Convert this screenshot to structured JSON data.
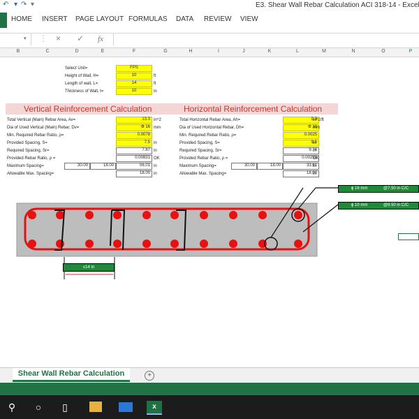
{
  "window": {
    "title": "E3. Shear Wall Rebar Calculation ACI 318-14 - Excel"
  },
  "ribbon": {
    "tabs": [
      "HOME",
      "INSERT",
      "PAGE LAYOUT",
      "FORMULAS",
      "DATA",
      "REVIEW",
      "VIEW"
    ]
  },
  "formula_bar": {
    "fx": "fx",
    "cancel": "×",
    "enter": "✓",
    "value": ""
  },
  "columns": [
    "B",
    "C",
    "D",
    "E",
    "F",
    "G",
    "H",
    "I",
    "J",
    "K",
    "L",
    "M",
    "N",
    "O",
    "P"
  ],
  "inputs": {
    "unit_label": "Select Unit=",
    "unit_value": "FPS",
    "height_label": "Height of Wall, H=",
    "height_value": "10",
    "height_unit": "ft",
    "length_label": "Length of wall, L=",
    "length_value": "14",
    "length_unit": "ft",
    "thick_label": "Thickness of Wall, t=",
    "thick_value": "10",
    "thick_unit": "in"
  },
  "vertical": {
    "title": "Vertical Reinforcement Calculation",
    "rows": [
      {
        "label": "Total Vertical (Main) Rebar Area, Av=",
        "value": "13.3",
        "unit": "in^2"
      },
      {
        "label": "Dia of Used Vertical (Main) Rebar, Dv=",
        "value": "Φ 16",
        "unit": "mm"
      },
      {
        "label": "Min. Required Rebar Ratio, ρ=",
        "value": "0.0078",
        "unit": ""
      },
      {
        "label": "Provided Spacing, S=",
        "value": "7.5",
        "unit": "in"
      },
      {
        "label": "Required Spacing, Sr=",
        "value": "7.87",
        "unit": "in"
      },
      {
        "label": "Provided Rebar Ratio, ρ =",
        "value": "0.00831",
        "unit": "OK"
      },
      {
        "label": "Maximum Spacing=",
        "value": "56.01",
        "unit": "in",
        "a": "30.00",
        "b": "18.00"
      },
      {
        "label": "Allowable Max. Spacing=",
        "value": "18.00",
        "unit": "in"
      }
    ]
  },
  "horizontal": {
    "title": "Horizontal Reinforcement Calculation",
    "rows": [
      {
        "label": "Total Horizontal Rebar Area, Ah=",
        "value": "0.3",
        "unit": "in^2/ft"
      },
      {
        "label": "Dia of Used Horizontal Rebar, Dh=",
        "value": "Φ 10",
        "unit": "mm"
      },
      {
        "label": "Min. Required Rebar Ratio, ρ=",
        "value": "0.0025",
        "unit": ""
      },
      {
        "label": "Provided Spacing, S=",
        "value": "9.5",
        "unit": "in"
      },
      {
        "label": "Required Spacing, Sr=",
        "value": "9.74",
        "unit": "in"
      },
      {
        "label": "Provided Rebar Ratio, ρ =",
        "value": "0.00258",
        "unit": "OK"
      },
      {
        "label": "Maximum Spacing=",
        "value": "33.61",
        "unit": "in",
        "a": "30.00",
        "b": "18.00"
      },
      {
        "label": "Allowable Max. Spacing=",
        "value": "18.00",
        "unit": "in"
      }
    ]
  },
  "drawing": {
    "label_vertical_dia": "ϕ 16 mm",
    "label_vertical_sp": "@7.50 in C/C",
    "label_horizontal_dia": "ϕ 10 mm",
    "label_horizontal_sp": "@9.50 in C/C",
    "spacing_label": "≤14 in",
    "colors": {
      "rebar": "#e81010",
      "wall": "#bdbdbd",
      "green": "#1e8a3a"
    }
  },
  "sheet": {
    "tab_name": "Shear Wall Rebar Calculation",
    "add": "+"
  },
  "taskbar": {
    "search": "⚲",
    "cortana": "○",
    "taskview": "▯",
    "excel": "x"
  }
}
